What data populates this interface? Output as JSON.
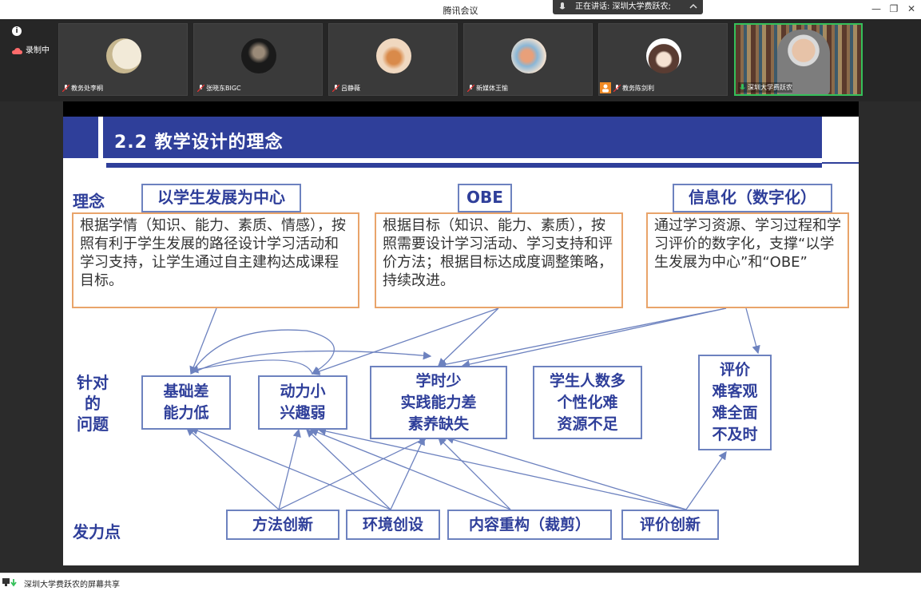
{
  "window": {
    "title": "腾讯会议",
    "speaking": "正在讲话: 深圳大学费跃农;"
  },
  "sidebar": {
    "recording": "录制中"
  },
  "participants": [
    {
      "name": "教务处李桐",
      "avatar": "moon"
    },
    {
      "name": "张晓东BIGC",
      "avatar": "portrait"
    },
    {
      "name": "吕静薇",
      "avatar": "cat"
    },
    {
      "name": "新媒体王愉",
      "avatar": "fox"
    },
    {
      "name": "教务陈剑利",
      "avatar": "girl"
    },
    {
      "name": "深圳大学费跃农",
      "avatar": "camera"
    }
  ],
  "share": {
    "footer": "深圳大学费跃农的屏幕共享"
  },
  "slide": {
    "title": "2.2 教学设计的理念",
    "row_labels": {
      "concept": "理念",
      "problems": [
        "针对",
        "的",
        "问题"
      ],
      "levers": "发力点"
    },
    "concepts": [
      {
        "tag": "以学生发展为中心",
        "text": "根据学情（知识、能力、素质、情感），按照有利于学生发展的路径设计学习活动和学习支持，让学生通过自主建构达成课程目标。"
      },
      {
        "tag": "OBE",
        "text": "根据目标（知识、能力、素质），按照需要设计学习活动、学习支持和评价方法；根据目标达成度调整策略，持续改进。"
      },
      {
        "tag": "信息化（数字化）",
        "text": "通过学习资源、学习过程和学习评价的数字化，支撑“以学生发展为中心”和“OBE”"
      }
    ],
    "problems": [
      [
        "基础差",
        "能力低"
      ],
      [
        "动力小",
        "兴趣弱"
      ],
      [
        "学时少",
        "实践能力差",
        "素养缺失"
      ],
      [
        "学生人数多",
        "个性化难",
        "资源不足"
      ],
      [
        "评价",
        "难客观",
        "难全面",
        "不及时"
      ]
    ],
    "levers": [
      "方法创新",
      "环境创设",
      "内容重构（裁剪）",
      "评价创新"
    ]
  },
  "colors": {
    "brand_blue": "#2f3f9a",
    "box_orange": "#e9a46a",
    "box_blue": "#6d82bf",
    "active_green": "#35c05a"
  }
}
